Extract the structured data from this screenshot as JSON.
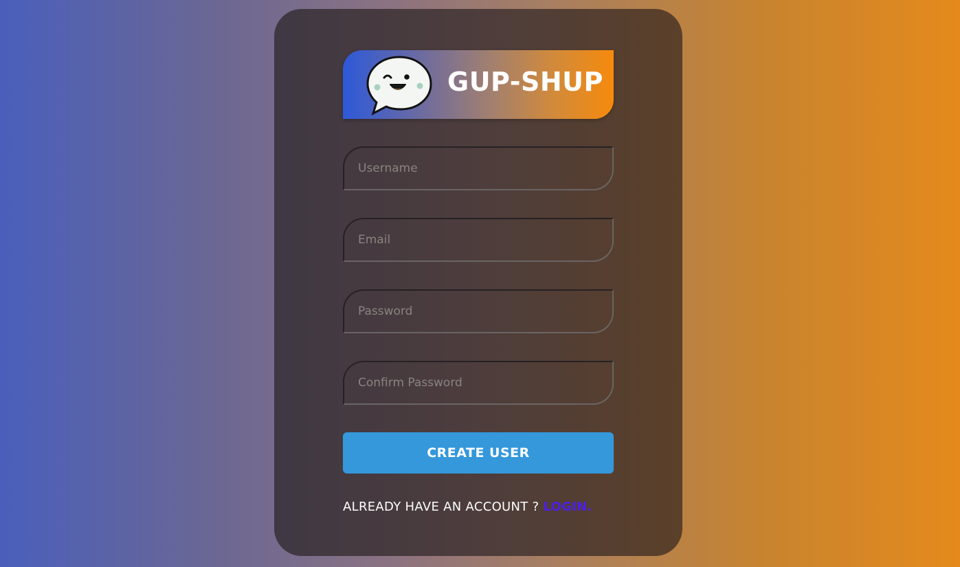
{
  "brand": {
    "title": "GUP-SHUP",
    "logo_icon": "chat-bubble-smiley-icon",
    "colors": {
      "gradient_start": "#2e59d9",
      "gradient_end": "#f68a0c"
    }
  },
  "form": {
    "username_placeholder": "Username",
    "email_placeholder": "Email",
    "password_placeholder": "Password",
    "confirm_password_placeholder": "Confirm Password",
    "submit_label": "CREATE USER",
    "submit_color": "#3498db"
  },
  "footer": {
    "prompt": "ALREADY HAVE AN ACCOUNT ? ",
    "login_label": "LOGIN.",
    "login_color": "#4b1ee6"
  }
}
